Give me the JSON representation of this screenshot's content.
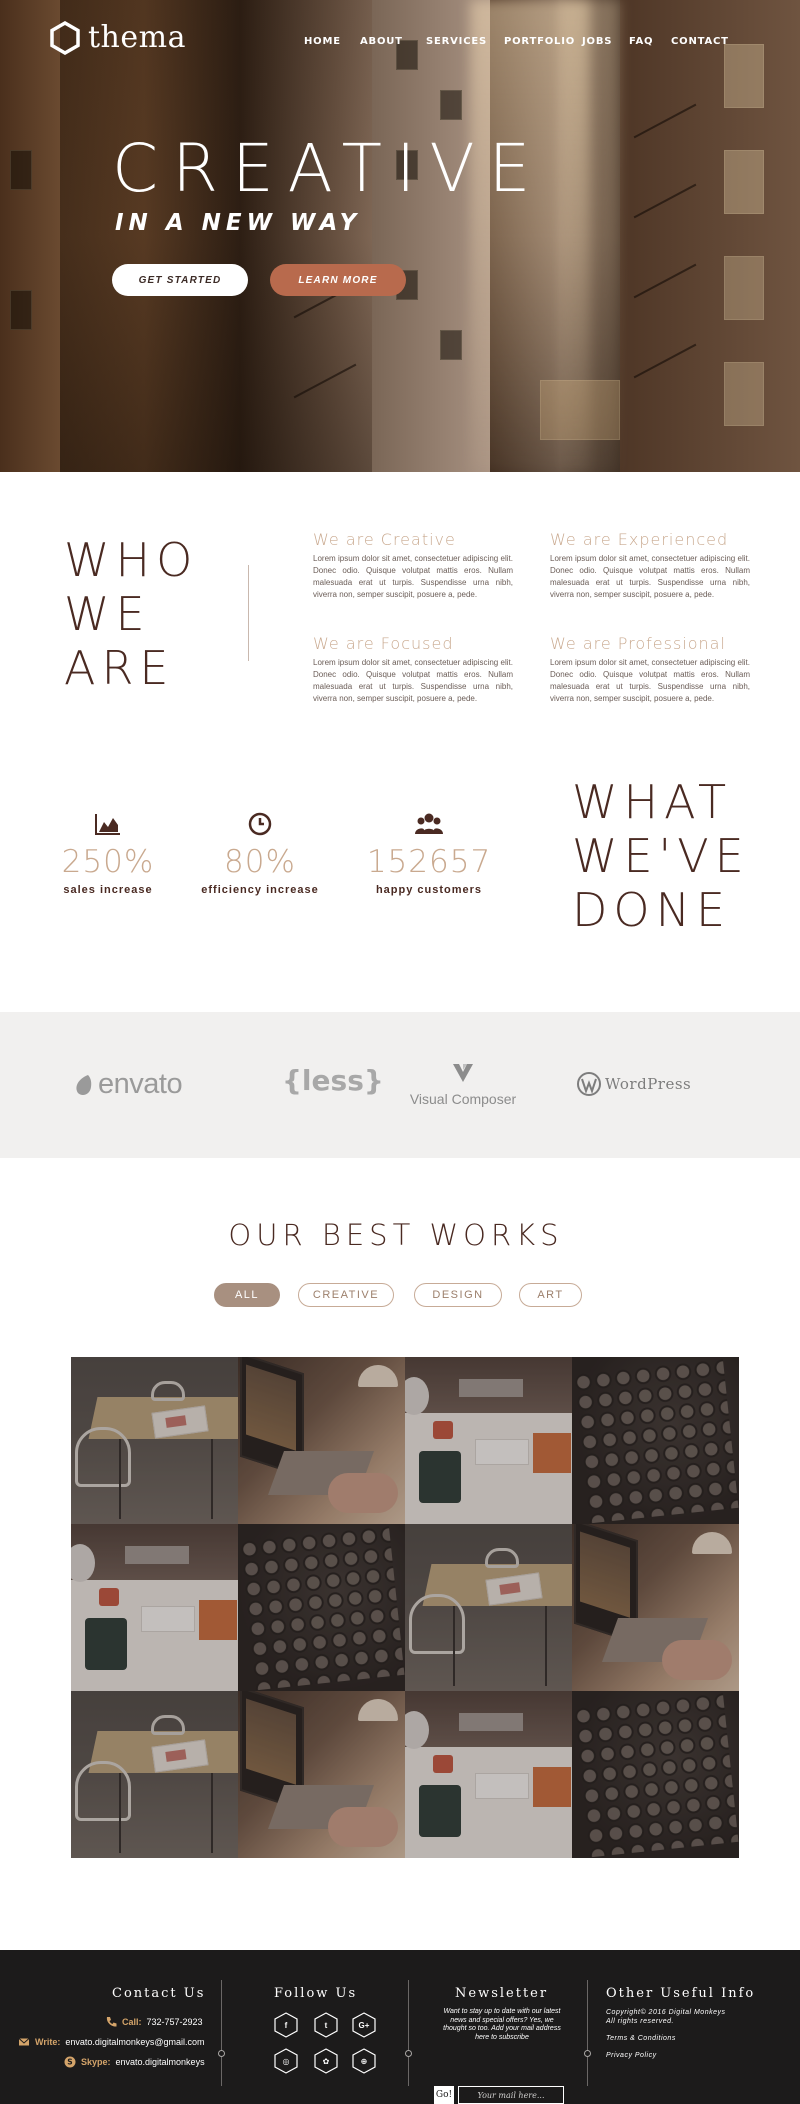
{
  "brand": {
    "name": "thema"
  },
  "nav": [
    "HOME",
    "ABOUT",
    "SERVICES",
    "PORTFOLIO",
    "JOBS",
    "FAQ",
    "CONTACT"
  ],
  "hero": {
    "title": "CREATIVE",
    "subtitle": "IN A NEW WAY",
    "primary_button": "GET STARTED",
    "secondary_button": "LEARN MORE"
  },
  "who": {
    "title_lines": [
      "WHO",
      "WE",
      "ARE"
    ],
    "features": [
      {
        "title": "We are Creative",
        "text": "Lorem ipsum dolor sit amet, consectetuer adipiscing elit. Donec odio. Quisque volutpat mattis eros. Nullam malesuada erat ut turpis. Suspendisse urna nibh, viverra non, semper suscipit, posuere a, pede."
      },
      {
        "title": "We are Experienced",
        "text": "Lorem ipsum dolor sit amet, consectetuer adipiscing elit. Donec odio. Quisque volutpat mattis eros. Nullam malesuada erat ut turpis. Suspendisse urna nibh, viverra non, semper suscipit, posuere a, pede."
      },
      {
        "title": "We are Focused",
        "text": "Lorem ipsum dolor sit amet, consectetuer adipiscing elit. Donec odio. Quisque volutpat mattis eros. Nullam malesuada erat ut turpis. Suspendisse urna nibh, viverra non, semper suscipit, posuere a, pede."
      },
      {
        "title": "We are Professional",
        "text": "Lorem ipsum dolor sit amet, consectetuer adipiscing elit. Donec odio. Quisque volutpat mattis eros. Nullam malesuada erat ut turpis. Suspendisse urna nibh, viverra non, semper suscipit, posuere a, pede."
      }
    ]
  },
  "stats": [
    {
      "icon": "area-chart-icon",
      "value": "250%",
      "label": "sales increase"
    },
    {
      "icon": "clock-icon",
      "value": "80%",
      "label": "efficiency increase"
    },
    {
      "icon": "users-icon",
      "value": "152657",
      "label": "happy customers"
    }
  ],
  "done": {
    "title_lines": [
      "WHAT",
      "WE'VE",
      "DONE"
    ]
  },
  "partners": [
    "envato",
    "{less}",
    "Visual Composer",
    "WordPress"
  ],
  "works": {
    "title": "OUR BEST WORKS",
    "filters": [
      "ALL",
      "CREATIVE",
      "DESIGN",
      "ART"
    ],
    "active_filter": "ALL",
    "tiles": [
      "table",
      "laptop",
      "desk",
      "typewriter",
      "desk",
      "typewriter",
      "table",
      "laptop",
      "table",
      "laptop",
      "desk",
      "typewriter"
    ]
  },
  "footer": {
    "contact": {
      "title": "Contact Us",
      "call_label": "Call:",
      "call_value": "732-757-2923",
      "write_label": "Write:",
      "write_value": "envato.digitalmonkeys@gmail.com",
      "skype_label": "Skype:",
      "skype_value": "envato.digitalmonkeys"
    },
    "follow": {
      "title": "Follow Us",
      "icons": [
        "facebook-icon",
        "twitter-icon",
        "google-plus-icon",
        "instagram-icon",
        "flickr-icon",
        "dribbble-icon"
      ],
      "glyphs": [
        "f",
        "t",
        "G+",
        "◎",
        "✿",
        "⊕"
      ]
    },
    "newsletter": {
      "title": "Newsletter",
      "description": "Want to stay up to date with our latest news and special offers? Yes, we thought so too. Add your mail address here to subscribe",
      "go_label": "Go!",
      "placeholder": "Your mail here..."
    },
    "other": {
      "title": "Other Useful Info",
      "lines": [
        "Copyright© 2016 Digital Monkeys",
        "All rights reserved.",
        "Terms & Conditions",
        "Privacy Policy"
      ]
    }
  },
  "colors": {
    "accent": "#b86a4d",
    "heading": "#4a2a22",
    "muted_gold": "#c9a98f",
    "footer_bg": "#1c1b1b"
  }
}
